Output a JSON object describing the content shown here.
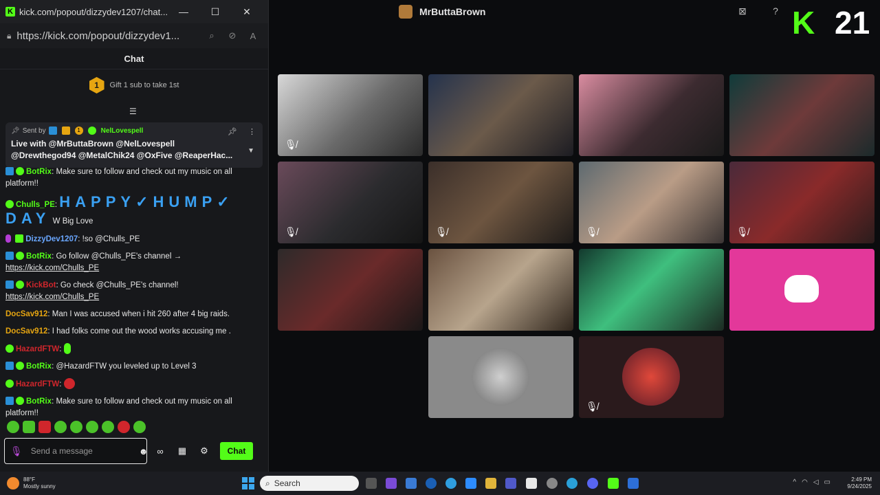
{
  "browser": {
    "title": "kick.com/popout/dizzydev1207/chat...",
    "url": "https://kick.com/popout/dizzydev1...",
    "minimize": "—",
    "maximize": "☐",
    "close": "✕"
  },
  "chat": {
    "header": "Chat",
    "gift_text": "Gift 1 sub to take 1st",
    "gift_rank": "1",
    "pinned": {
      "sent_by_label": "Sent by",
      "badge_count": "1",
      "sender": "NelLovespell",
      "message": "Live with @MrButtaBrown @NelLovespell @Drewthegod94 @MetalChik24 @OxFive @ReaperHac..."
    },
    "messages": [
      {
        "user": "BotRix",
        "user_color": "#53fc18",
        "text": ": Make sure to follow and check out my music on all platform!!"
      },
      {
        "user": "Chulls_PE",
        "user_color": "#53fc18",
        "happy": "HAPPY✓HUMP✓",
        "day": "DAY",
        "text": "W Big Love"
      },
      {
        "user": "DizzyDev1207",
        "user_color": "#6aa7ff",
        "text": ": !so @Chulls_PE"
      },
      {
        "user": "BotRix",
        "user_color": "#53fc18",
        "text": ": Go follow @Chulls_PE's channel →",
        "link": "https://kick.com/Chulls_PE"
      },
      {
        "user": "KickBot",
        "user_color": "#d0262c",
        "text": ": Go check @Chulls_PE's channel!",
        "link": "https://kick.com/Chulls_PE"
      },
      {
        "user": "DocSav912",
        "user_color": "#e6a511",
        "text": ": Man I was accused when i hit 260 after 4 big raids."
      },
      {
        "user": "DocSav912",
        "user_color": "#e6a511",
        "text": ": I had folks come out the wood works accusing me ."
      },
      {
        "user": "HazardFTW",
        "user_color": "#d0262c",
        "text": ":"
      },
      {
        "user": "BotRix",
        "user_color": "#53fc18",
        "text": ": @HazardFTW you leveled up to Level 3"
      },
      {
        "user": "HazardFTW",
        "user_color": "#d0262c",
        "text": ":"
      },
      {
        "user": "BotRix",
        "user_color": "#53fc18",
        "text": ": Make sure to follow and check out my music on all platform!!"
      }
    ],
    "input_placeholder": "Send a message",
    "send_label": "Chat"
  },
  "stream": {
    "streamer": "MrButtaBrown",
    "brand": "K",
    "participants": "21"
  },
  "taskbar": {
    "temp": "88°F",
    "weather": "Mostly sunny",
    "search_label": "Search",
    "time": "2:49 PM",
    "date": "9/24/2025"
  }
}
